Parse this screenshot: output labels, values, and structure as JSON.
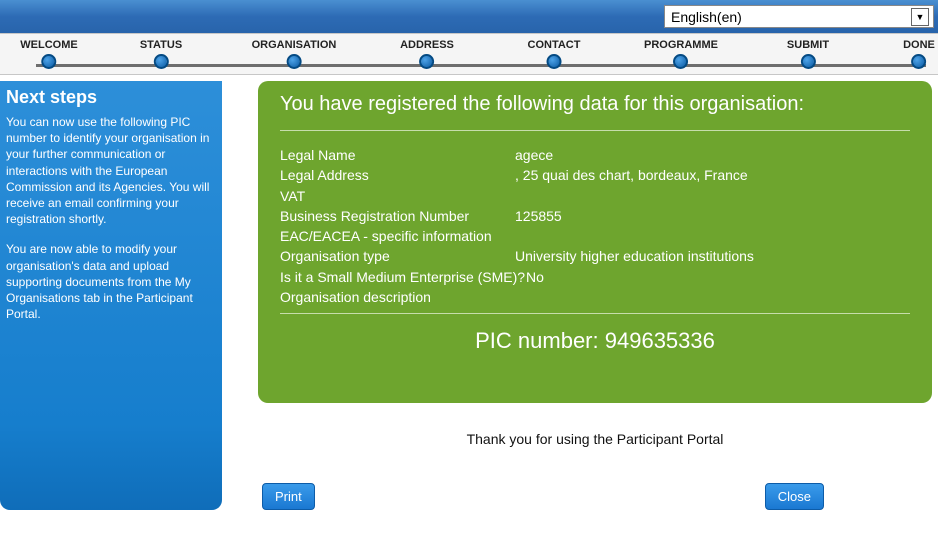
{
  "language": {
    "selected": "English(en)"
  },
  "steps": [
    {
      "label": "WELCOME"
    },
    {
      "label": "STATUS"
    },
    {
      "label": "ORGANISATION"
    },
    {
      "label": "ADDRESS"
    },
    {
      "label": "CONTACT"
    },
    {
      "label": "PROGRAMME"
    },
    {
      "label": "SUBMIT"
    },
    {
      "label": "DONE"
    }
  ],
  "sidebar": {
    "title": "Next steps",
    "para1": "You can now use the following PIC number to identify your organisation in your further communication or interactions with the European Commission and its Agencies. You will receive an email confirming your registration shortly.",
    "para2": "You are now able to modify your organisation's data and upload supporting documents from the My Organisations tab in the Participant Portal."
  },
  "main": {
    "heading": "You have registered the following data for this organisation:",
    "fields": {
      "legal_name_label": "Legal Name",
      "legal_name_value": "agece",
      "legal_address_label": "Legal Address",
      "legal_address_value": ", 25 quai des chart, bordeaux, France",
      "vat_label": "VAT",
      "vat_value": "",
      "brn_label": "Business Registration Number",
      "brn_value": "125855",
      "eac_label": "EAC/EACEA - specific information",
      "org_type_label": "Organisation type",
      "org_type_value": "University higher education institutions",
      "sme_label": "Is it a Small Medium Enterprise (SME)?",
      "sme_value": "No",
      "org_desc_label": "Organisation description"
    },
    "pic_label": "PIC number:",
    "pic_value": "949635336",
    "thanks": "Thank you for using the Participant Portal"
  },
  "buttons": {
    "print": "Print",
    "close": "Close"
  }
}
